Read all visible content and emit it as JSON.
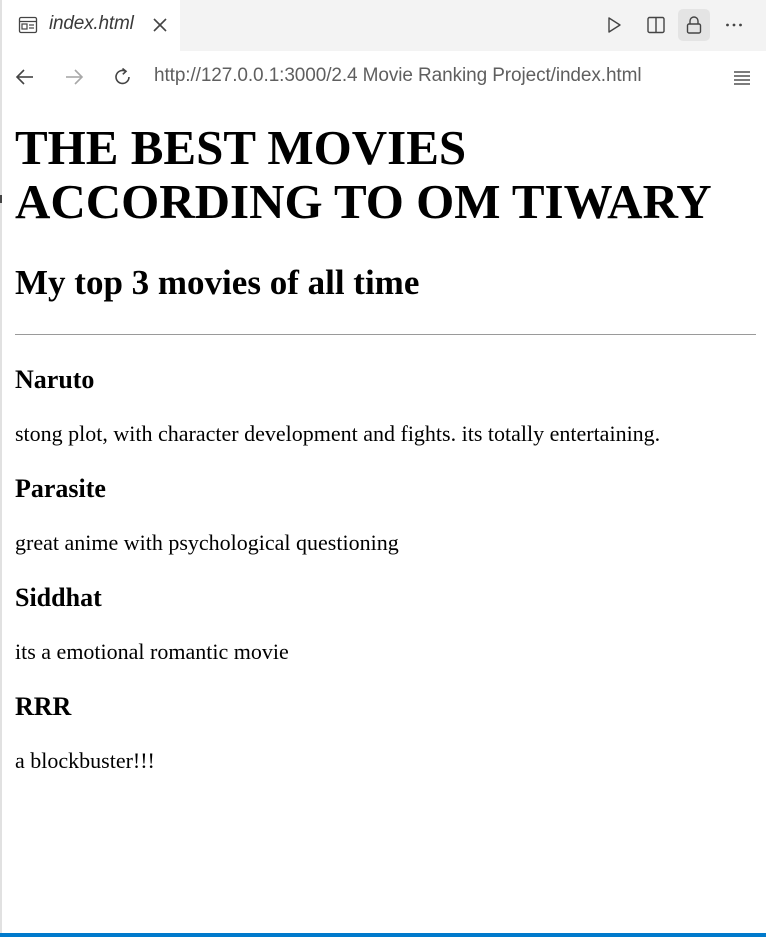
{
  "tab": {
    "title": "index.html",
    "icon": "preview-icon"
  },
  "nav": {
    "url": "http://127.0.0.1:3000/2.4 Movie Ranking Project/index.html"
  },
  "colors": {
    "accent": "#007acc",
    "tab_bg": "#f3f3f3"
  },
  "page": {
    "title": "THE BEST MOVIES ACCORDING TO OM TIWARY",
    "subtitle": "My top 3 movies of all time",
    "movies": [
      {
        "name": "Naruto",
        "description": "stong plot, with character development and fights. its totally entertaining."
      },
      {
        "name": "Parasite",
        "description": "great anime with psychological questioning"
      },
      {
        "name": "Siddhat",
        "description": "its a emotional romantic movie"
      },
      {
        "name": "RRR",
        "description": "a blockbuster!!!"
      }
    ]
  }
}
